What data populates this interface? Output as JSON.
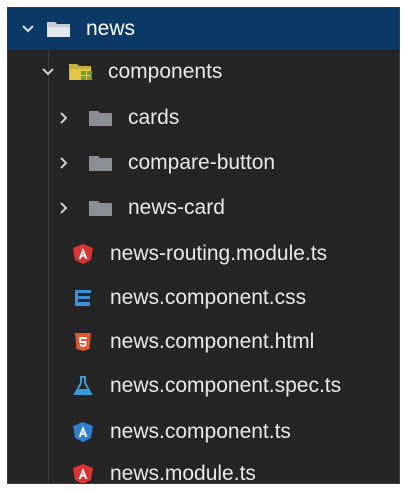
{
  "explorer": {
    "root": {
      "label": "news",
      "icon": "folder-open-icon",
      "expanded": true
    },
    "components": {
      "label": "components",
      "icon": "folder-components-open-icon",
      "expanded": true
    },
    "folders": [
      {
        "label": "cards",
        "icon": "folder-icon"
      },
      {
        "label": "compare-button",
        "icon": "folder-icon"
      },
      {
        "label": "news-card",
        "icon": "folder-icon"
      }
    ],
    "files": [
      {
        "label": "news-routing.module.ts",
        "icon": "angular-icon"
      },
      {
        "label": "news.component.css",
        "icon": "css-icon"
      },
      {
        "label": "news.component.html",
        "icon": "html5-icon"
      },
      {
        "label": "news.component.spec.ts",
        "icon": "flask-test-icon"
      },
      {
        "label": "news.component.ts",
        "icon": "angular-component-icon"
      },
      {
        "label": "news.module.ts",
        "icon": "angular-icon"
      }
    ]
  },
  "colors": {
    "background": "#252526",
    "selected": "#0c3a66",
    "folder": "#8a8f96",
    "angular": "#dd3333",
    "css": "#3d8fe0",
    "html": "#e4572e",
    "spec": "#3b9ad9",
    "component": "#2f7fd6"
  }
}
